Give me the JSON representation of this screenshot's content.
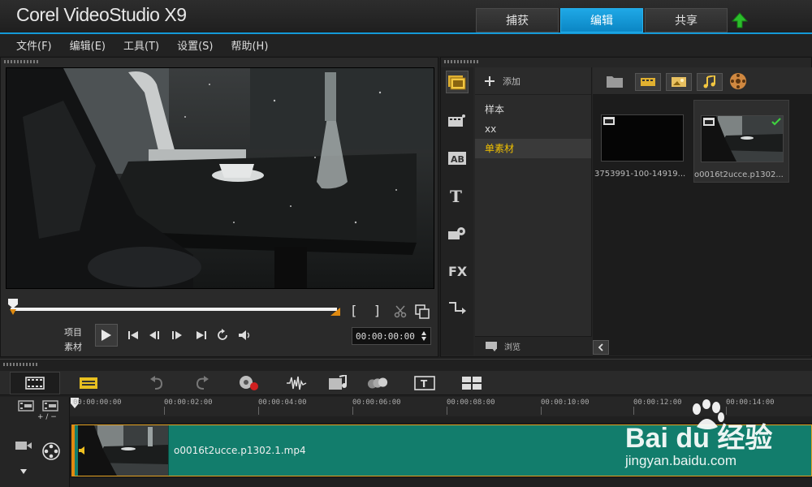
{
  "app": {
    "brand": "Corel VideoStudio X9",
    "tabs": [
      {
        "label": "捕获",
        "active": false
      },
      {
        "label": "编辑",
        "active": true
      },
      {
        "label": "共享",
        "active": false
      }
    ],
    "accent_color": "#149ad8"
  },
  "menu": {
    "items": [
      "文件(F)",
      "编辑(E)",
      "工具(T)",
      "设置(S)",
      "帮助(H)"
    ]
  },
  "preview": {
    "mode_project": "项目",
    "mode_clip": "素材",
    "timecode": "00:00:00:00",
    "trim_start": "[",
    "trim_end": "]",
    "scrub_progress": 0.0
  },
  "library": {
    "add_label": "添加",
    "browse_label": "浏览",
    "folders": [
      {
        "label": "样本",
        "selected": false
      },
      {
        "label": "xx",
        "selected": false
      },
      {
        "label": "单素材",
        "selected": true
      }
    ],
    "thumbnails": [
      {
        "caption": "3753991-100-14919...",
        "selected": false,
        "checked": false
      },
      {
        "caption": "o0016t2ucce.p1302...",
        "selected": true,
        "checked": true
      }
    ],
    "tool_icons": [
      "media-icon",
      "instant-project-icon",
      "transition-icon",
      "title-icon",
      "graphic-icon",
      "filter-icon",
      "path-icon"
    ]
  },
  "timeline": {
    "ruler_labels": [
      "00:00:00:00",
      "00:00:02:00",
      "00:00:04:00",
      "00:00:06:00",
      "00:00:08:00",
      "00:00:10:00",
      "00:00:12:00",
      "00:00:14:00"
    ],
    "zoom_label": "+ / −",
    "clip_name": "o0016t2ucce.p1302.1.mp4",
    "clip_color": "#127d6c"
  },
  "watermark": {
    "logo": "Bai du 经验",
    "url": "jingyan.baidu.com"
  }
}
